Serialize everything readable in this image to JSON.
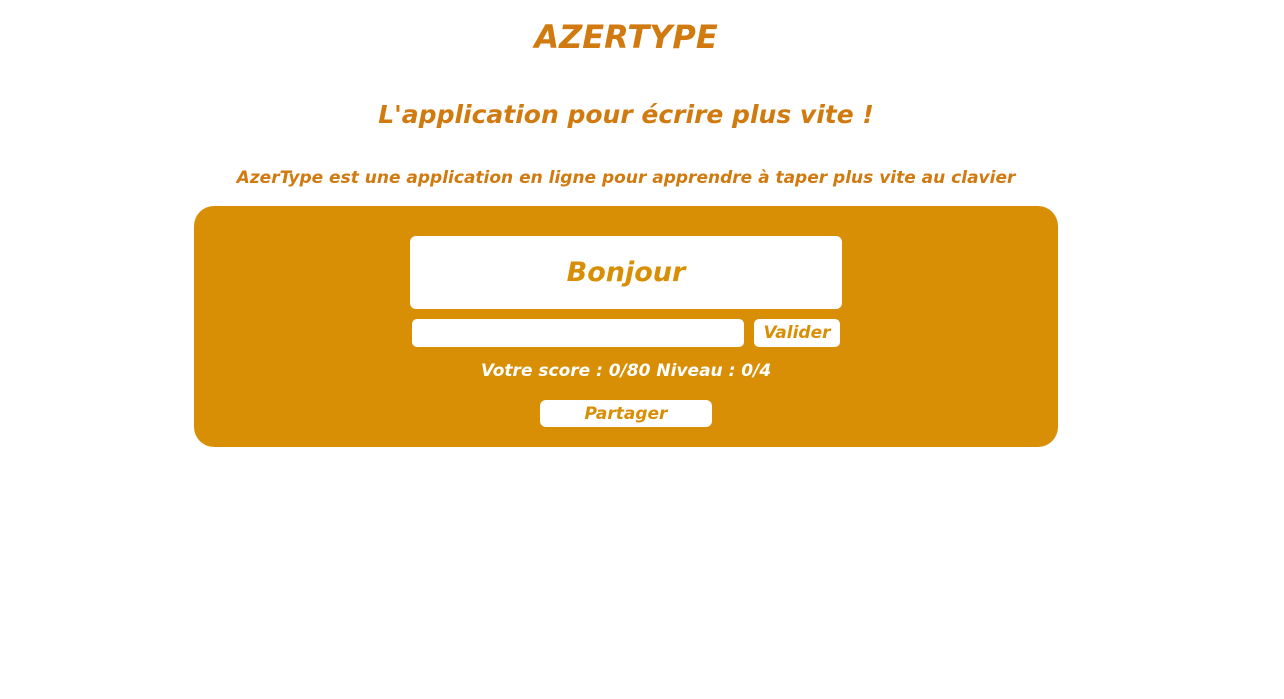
{
  "header": {
    "title": "AZERTYPE",
    "tagline": "L'application pour écrire plus vite !",
    "description": "AzerType est une application en ligne pour apprendre à taper plus vite au clavier"
  },
  "game": {
    "proposed_word": "Bonjour",
    "input_value": "",
    "input_placeholder": "",
    "validate_label": "Valider",
    "score_text": "Votre score : 0/80 Niveau : 0/4",
    "share_label": "Partager"
  },
  "colors": {
    "accent_text": "#d07a10",
    "panel_background": "#d88f05",
    "page_background": "#ffffff"
  }
}
